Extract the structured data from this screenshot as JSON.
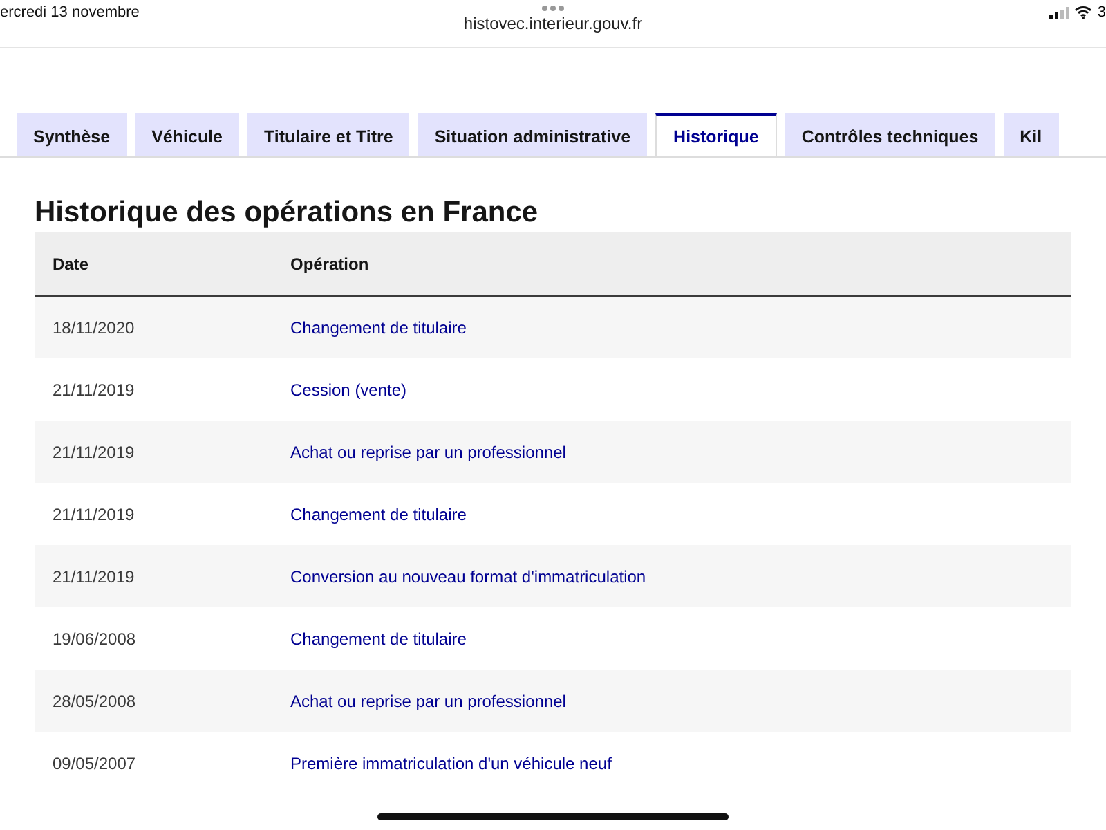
{
  "status_bar": {
    "date": "ercredi 13 novembre",
    "url": "histovec.interieur.gouv.fr",
    "battery": "3"
  },
  "tabs": [
    {
      "label": "Synthèse",
      "selected": false
    },
    {
      "label": "Véhicule",
      "selected": false
    },
    {
      "label": "Titulaire et Titre",
      "selected": false
    },
    {
      "label": "Situation administrative",
      "selected": false
    },
    {
      "label": "Historique",
      "selected": true
    },
    {
      "label": "Contrôles techniques",
      "selected": false
    },
    {
      "label": "Kil",
      "selected": false
    }
  ],
  "section": {
    "title": "Historique des opérations en France"
  },
  "table": {
    "columns": [
      "Date",
      "Opération"
    ],
    "rows": [
      {
        "date": "18/11/2020",
        "operation": "Changement de titulaire"
      },
      {
        "date": "21/11/2019",
        "operation": "Cession (vente)"
      },
      {
        "date": "21/11/2019",
        "operation": "Achat ou reprise par un professionnel"
      },
      {
        "date": "21/11/2019",
        "operation": "Changement de titulaire"
      },
      {
        "date": "21/11/2019",
        "operation": "Conversion au nouveau format d'immatriculation"
      },
      {
        "date": "19/06/2008",
        "operation": "Changement de titulaire"
      },
      {
        "date": "28/05/2008",
        "operation": "Achat ou reprise par un professionnel"
      },
      {
        "date": "09/05/2007",
        "operation": "Première immatriculation d'un véhicule neuf"
      }
    ]
  }
}
